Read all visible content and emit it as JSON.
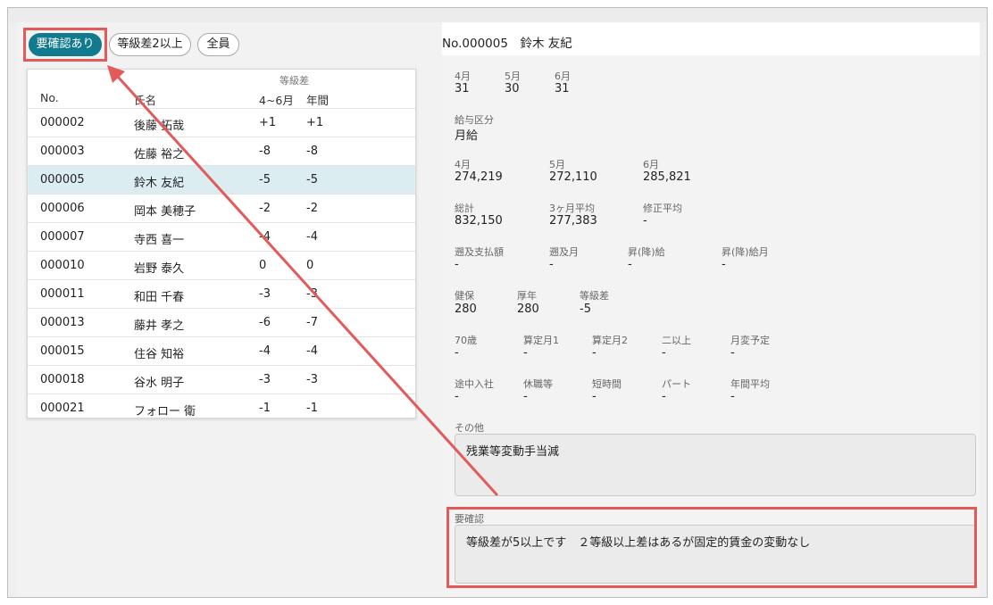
{
  "filters": {
    "needs_check": "要確認あり",
    "grade_diff_2plus": "等級差2以上",
    "all": "全員"
  },
  "table": {
    "group_header": "等級差",
    "headers": {
      "no": "No.",
      "name": "氏名",
      "q": "4~6月",
      "year": "年間"
    },
    "rows": [
      {
        "no": "000002",
        "name": "後藤 拓哉",
        "q": "+1",
        "year": "+1"
      },
      {
        "no": "000003",
        "name": "佐藤 裕之",
        "q": "-8",
        "year": "-8"
      },
      {
        "no": "000005",
        "name": "鈴木 友紀",
        "q": "-5",
        "year": "-5"
      },
      {
        "no": "000006",
        "name": "岡本 美穂子",
        "q": "-2",
        "year": "-2"
      },
      {
        "no": "000007",
        "name": "寺西 喜一",
        "q": "-4",
        "year": "-4"
      },
      {
        "no": "000010",
        "name": "岩野 泰久",
        "q": "0",
        "year": "0"
      },
      {
        "no": "000011",
        "name": "和田 千春",
        "q": "-3",
        "year": "-3"
      },
      {
        "no": "000013",
        "name": "藤井 孝之",
        "q": "-6",
        "year": "-7"
      },
      {
        "no": "000015",
        "name": "住谷 知裕",
        "q": "-4",
        "year": "-4"
      },
      {
        "no": "000018",
        "name": "谷水 明子",
        "q": "-3",
        "year": "-3"
      },
      {
        "no": "000021",
        "name": "フォロー 衛",
        "q": "-1",
        "year": "-1"
      }
    ],
    "selected_no": "000005"
  },
  "detail": {
    "title": "No.000005　鈴木 友紀",
    "days": {
      "apr_label": "4月",
      "apr": "31",
      "may_label": "5月",
      "may": "30",
      "jun_label": "6月",
      "jun": "31"
    },
    "pay_type": {
      "label": "給与区分",
      "value": "月給"
    },
    "pay": {
      "apr_label": "4月",
      "apr": "274,219",
      "may_label": "5月",
      "may": "272,110",
      "jun_label": "6月",
      "jun": "285,821"
    },
    "totals": {
      "total_label": "総計",
      "total": "832,150",
      "avg_label": "3ヶ月平均",
      "avg": "277,383",
      "adj_label": "修正平均",
      "adj": "-"
    },
    "retro": {
      "amount_label": "遡及支払額",
      "amount": "-",
      "month_label": "遡及月",
      "month": "-",
      "raise_label": "昇(降)給",
      "raise": "-",
      "raise_month_label": "昇(降)給月",
      "raise_month": "-"
    },
    "grades": {
      "health_label": "健保",
      "health": "280",
      "pension_label": "厚年",
      "pension": "280",
      "diff_label": "等級差",
      "diff": "-5"
    },
    "flags1": {
      "age70_label": "70歳",
      "age70": "-",
      "std1_label": "算定月1",
      "std1": "-",
      "std2_label": "算定月2",
      "std2": "-",
      "two_plus_label": "二以上",
      "two_plus": "-",
      "change_label": "月変予定",
      "change": "-"
    },
    "flags2": {
      "mid_label": "途中入社",
      "mid": "-",
      "leave_label": "休職等",
      "leave": "-",
      "short_label": "短時間",
      "short": "-",
      "part_label": "パート",
      "part": "-",
      "annual_label": "年間平均",
      "annual": "-"
    },
    "other": {
      "label": "その他",
      "value": "残業等変動手当減"
    },
    "check": {
      "label": "要確認",
      "value": "等級差が5以上です　２等級以上差はあるが固定的賃金の変動なし"
    }
  },
  "colors": {
    "accent": "#127a8e",
    "highlight": "#e25a5a",
    "selected_row": "#dcedf1"
  }
}
